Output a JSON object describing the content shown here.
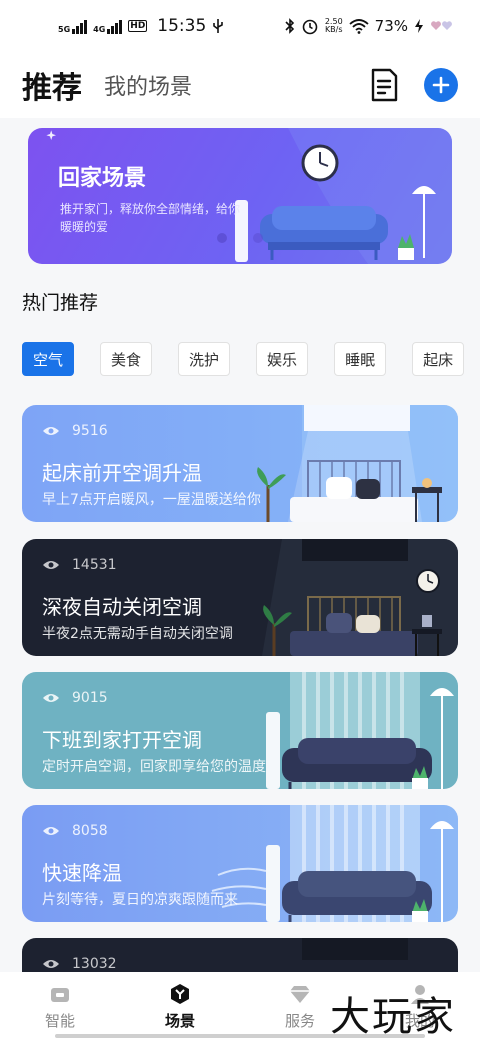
{
  "status_bar": {
    "sim1": "5G",
    "sim2": "4G",
    "hd": "HD",
    "time": "15:35",
    "speed_value": "2.50",
    "speed_unit": "KB/s",
    "battery": "73%"
  },
  "header": {
    "tab_recommend": "推荐",
    "tab_my_scenes": "我的场景"
  },
  "banner": {
    "title": "回家场景",
    "desc": "推开家门，释放你全部情绪，给你暖暖的爱"
  },
  "section": {
    "hot_title": "热门推荐"
  },
  "categories": [
    {
      "label": "空气",
      "active": true
    },
    {
      "label": "美食",
      "active": false
    },
    {
      "label": "洗护",
      "active": false
    },
    {
      "label": "娱乐",
      "active": false
    },
    {
      "label": "睡眠",
      "active": false
    },
    {
      "label": "起床",
      "active": false
    }
  ],
  "scenes": [
    {
      "views": "9516",
      "title": "起床前开空调升温",
      "desc": "早上7点开启暖风，一屋温暖送给你"
    },
    {
      "views": "14531",
      "title": "深夜自动关闭空调",
      "desc": "半夜2点无需动手自动关闭空调"
    },
    {
      "views": "9015",
      "title": "下班到家打开空调",
      "desc": "定时开启空调，回家即享给您的温度"
    },
    {
      "views": "8058",
      "title": "快速降温",
      "desc": "片刻等待，夏日的凉爽跟随而来"
    },
    {
      "views": "13032",
      "title": "",
      "desc": ""
    }
  ],
  "bottom_nav": [
    {
      "label": "智能",
      "active": false
    },
    {
      "label": "场景",
      "active": true
    },
    {
      "label": "服务",
      "active": false
    },
    {
      "label": "我的",
      "active": false
    }
  ],
  "watermark": "大玩家",
  "colors": {
    "accent": "#1a73e8",
    "banner_purple": "#7d52f0",
    "card_blue": "#7aa3f5",
    "card_dark": "#1f2530",
    "card_teal": "#6fb2c2"
  }
}
